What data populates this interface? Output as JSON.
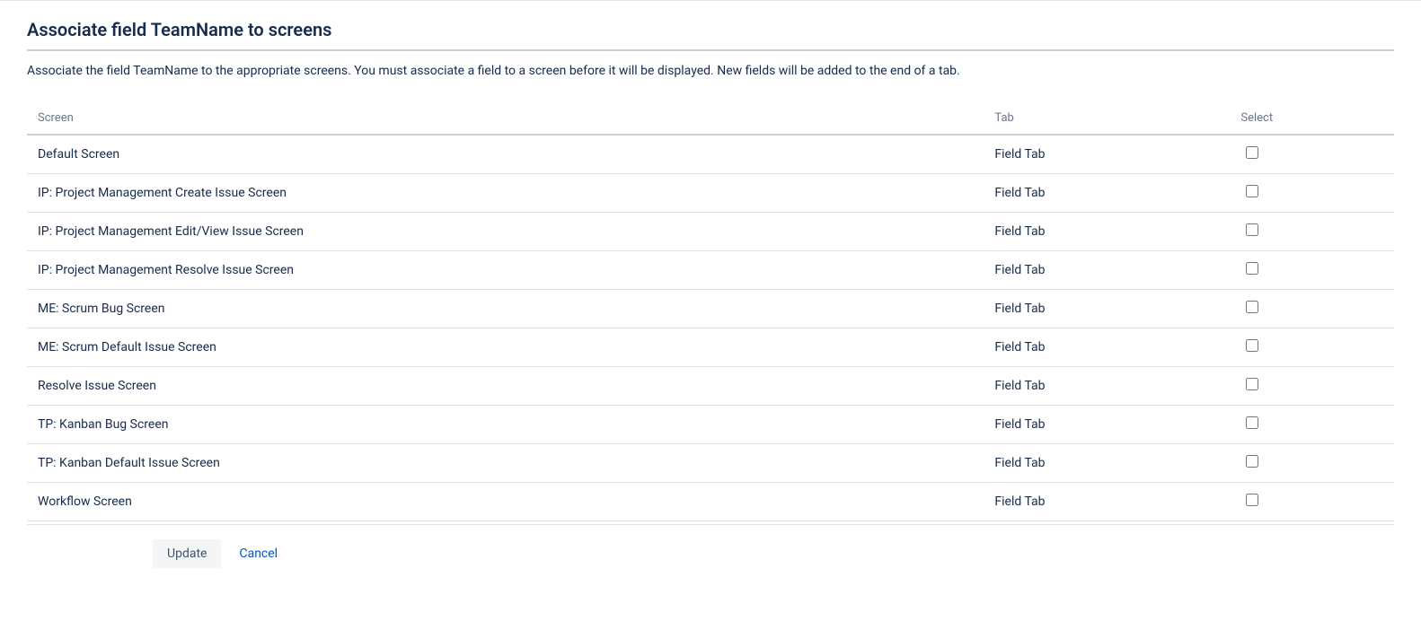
{
  "header": {
    "title": "Associate field TeamName to screens",
    "description": "Associate the field TeamName to the appropriate screens. You must associate a field to a screen before it will be displayed. New fields will be added to the end of a tab."
  },
  "table": {
    "columns": {
      "screen": "Screen",
      "tab": "Tab",
      "select": "Select"
    },
    "rows": [
      {
        "screen": "Default Screen",
        "tab": "Field Tab",
        "selected": false
      },
      {
        "screen": "IP: Project Management Create Issue Screen",
        "tab": "Field Tab",
        "selected": false
      },
      {
        "screen": "IP: Project Management Edit/View Issue Screen",
        "tab": "Field Tab",
        "selected": false
      },
      {
        "screen": "IP: Project Management Resolve Issue Screen",
        "tab": "Field Tab",
        "selected": false
      },
      {
        "screen": "ME: Scrum Bug Screen",
        "tab": "Field Tab",
        "selected": false
      },
      {
        "screen": "ME: Scrum Default Issue Screen",
        "tab": "Field Tab",
        "selected": false
      },
      {
        "screen": "Resolve Issue Screen",
        "tab": "Field Tab",
        "selected": false
      },
      {
        "screen": "TP: Kanban Bug Screen",
        "tab": "Field Tab",
        "selected": false
      },
      {
        "screen": "TP: Kanban Default Issue Screen",
        "tab": "Field Tab",
        "selected": false
      },
      {
        "screen": "Workflow Screen",
        "tab": "Field Tab",
        "selected": false
      }
    ]
  },
  "actions": {
    "update_label": "Update",
    "cancel_label": "Cancel"
  }
}
